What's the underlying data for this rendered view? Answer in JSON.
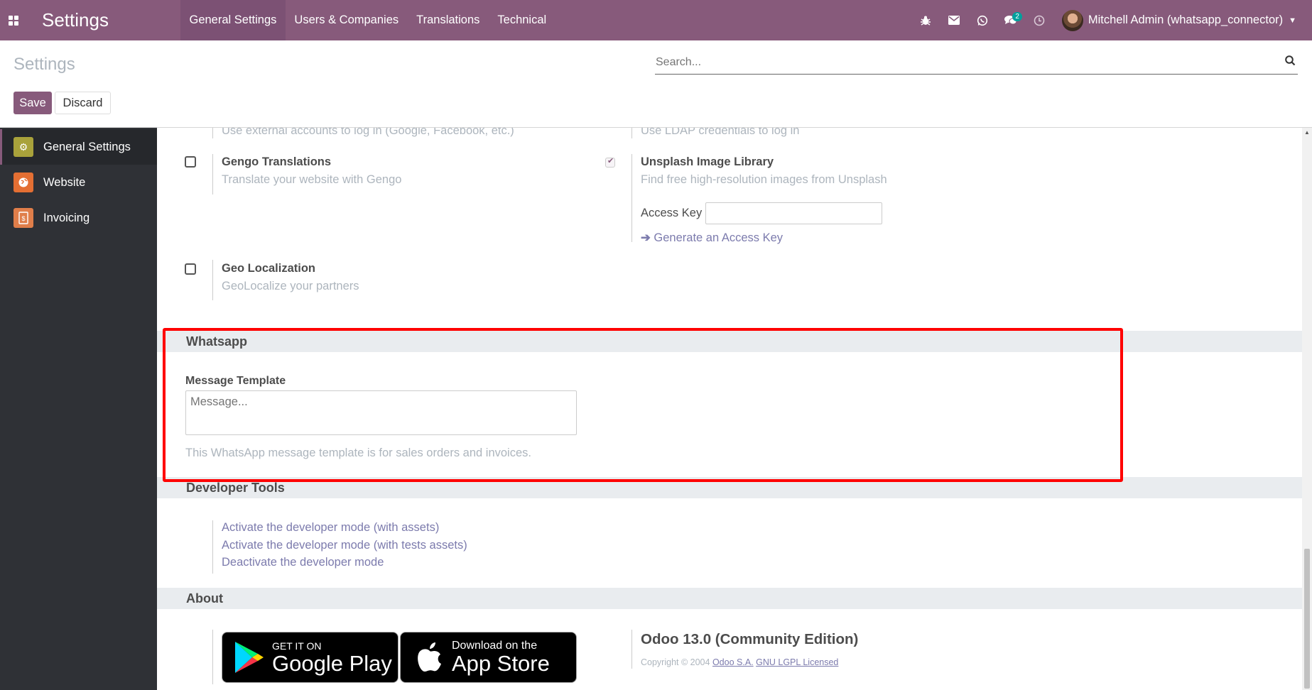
{
  "navbar": {
    "brand": "Settings",
    "menu": [
      "General Settings",
      "Users & Companies",
      "Translations",
      "Technical"
    ],
    "chat_count": "2",
    "user_name": "Mitchell Admin (whatsapp_connector)"
  },
  "control_panel": {
    "title": "Settings",
    "search_placeholder": "Search...",
    "save_label": "Save",
    "discard_label": "Discard"
  },
  "sidebar": {
    "items": [
      {
        "label": "General Settings",
        "color": "#a9a23b"
      },
      {
        "label": "Website",
        "color": "#e46f33"
      },
      {
        "label": "Invoicing",
        "color": "#e07e4a"
      }
    ]
  },
  "integrations": {
    "oauth_desc": "Use external accounts to log in (Google, Facebook, etc.)",
    "ldap_desc": "Use LDAP credentials to log in",
    "gengo_title": "Gengo Translations",
    "gengo_desc": "Translate your website with Gengo",
    "unsplash_title": "Unsplash Image Library",
    "unsplash_desc": "Find free high-resolution images from Unsplash",
    "access_key_label": "Access Key",
    "generate_key_link": "Generate an Access Key",
    "geo_title": "Geo Localization",
    "geo_desc": "GeoLocalize your partners"
  },
  "whatsapp": {
    "section_title": "Whatsapp",
    "field_label": "Message Template",
    "placeholder": "Message...",
    "help_text": "This WhatsApp message template is for sales orders and invoices."
  },
  "developer_tools": {
    "section_title": "Developer Tools",
    "links": [
      "Activate the developer mode (with assets)",
      "Activate the developer mode (with tests assets)",
      "Deactivate the developer mode"
    ]
  },
  "about": {
    "section_title": "About",
    "google_small": "GET IT ON",
    "google_big": "Google Play",
    "apple_small": "Download on the",
    "apple_big": "App Store",
    "version": "Odoo 13.0 (Community Edition)",
    "copyright": "Copyright © 2004",
    "company_link": "Odoo S.A.",
    "license_link": "GNU LGPL Licensed"
  }
}
